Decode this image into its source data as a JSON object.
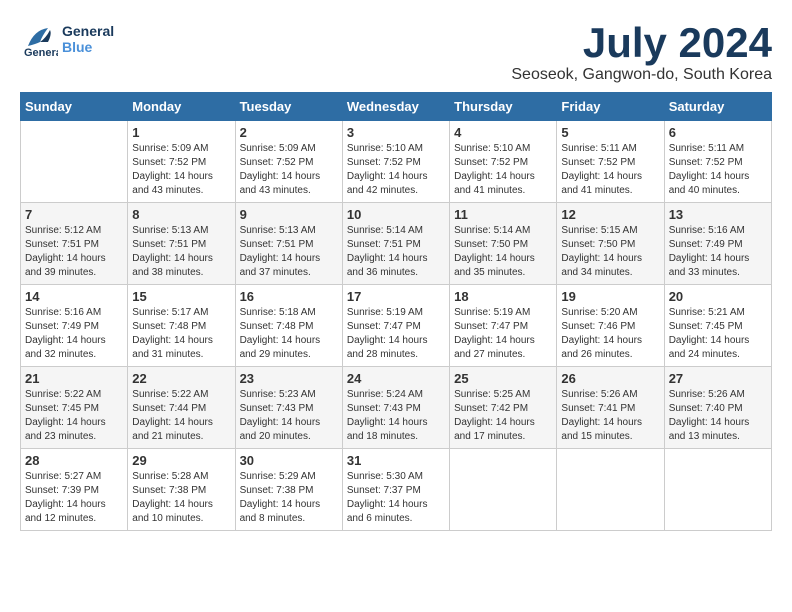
{
  "header": {
    "logo_general": "General",
    "logo_blue": "Blue",
    "month_year": "July 2024",
    "location": "Seoseok, Gangwon-do, South Korea"
  },
  "days_of_week": [
    "Sunday",
    "Monday",
    "Tuesday",
    "Wednesday",
    "Thursday",
    "Friday",
    "Saturday"
  ],
  "weeks": [
    [
      {
        "day": "",
        "info": ""
      },
      {
        "day": "1",
        "info": "Sunrise: 5:09 AM\nSunset: 7:52 PM\nDaylight: 14 hours\nand 43 minutes."
      },
      {
        "day": "2",
        "info": "Sunrise: 5:09 AM\nSunset: 7:52 PM\nDaylight: 14 hours\nand 43 minutes."
      },
      {
        "day": "3",
        "info": "Sunrise: 5:10 AM\nSunset: 7:52 PM\nDaylight: 14 hours\nand 42 minutes."
      },
      {
        "day": "4",
        "info": "Sunrise: 5:10 AM\nSunset: 7:52 PM\nDaylight: 14 hours\nand 41 minutes."
      },
      {
        "day": "5",
        "info": "Sunrise: 5:11 AM\nSunset: 7:52 PM\nDaylight: 14 hours\nand 41 minutes."
      },
      {
        "day": "6",
        "info": "Sunrise: 5:11 AM\nSunset: 7:52 PM\nDaylight: 14 hours\nand 40 minutes."
      }
    ],
    [
      {
        "day": "7",
        "info": "Sunrise: 5:12 AM\nSunset: 7:51 PM\nDaylight: 14 hours\nand 39 minutes."
      },
      {
        "day": "8",
        "info": "Sunrise: 5:13 AM\nSunset: 7:51 PM\nDaylight: 14 hours\nand 38 minutes."
      },
      {
        "day": "9",
        "info": "Sunrise: 5:13 AM\nSunset: 7:51 PM\nDaylight: 14 hours\nand 37 minutes."
      },
      {
        "day": "10",
        "info": "Sunrise: 5:14 AM\nSunset: 7:51 PM\nDaylight: 14 hours\nand 36 minutes."
      },
      {
        "day": "11",
        "info": "Sunrise: 5:14 AM\nSunset: 7:50 PM\nDaylight: 14 hours\nand 35 minutes."
      },
      {
        "day": "12",
        "info": "Sunrise: 5:15 AM\nSunset: 7:50 PM\nDaylight: 14 hours\nand 34 minutes."
      },
      {
        "day": "13",
        "info": "Sunrise: 5:16 AM\nSunset: 7:49 PM\nDaylight: 14 hours\nand 33 minutes."
      }
    ],
    [
      {
        "day": "14",
        "info": "Sunrise: 5:16 AM\nSunset: 7:49 PM\nDaylight: 14 hours\nand 32 minutes."
      },
      {
        "day": "15",
        "info": "Sunrise: 5:17 AM\nSunset: 7:48 PM\nDaylight: 14 hours\nand 31 minutes."
      },
      {
        "day": "16",
        "info": "Sunrise: 5:18 AM\nSunset: 7:48 PM\nDaylight: 14 hours\nand 29 minutes."
      },
      {
        "day": "17",
        "info": "Sunrise: 5:19 AM\nSunset: 7:47 PM\nDaylight: 14 hours\nand 28 minutes."
      },
      {
        "day": "18",
        "info": "Sunrise: 5:19 AM\nSunset: 7:47 PM\nDaylight: 14 hours\nand 27 minutes."
      },
      {
        "day": "19",
        "info": "Sunrise: 5:20 AM\nSunset: 7:46 PM\nDaylight: 14 hours\nand 26 minutes."
      },
      {
        "day": "20",
        "info": "Sunrise: 5:21 AM\nSunset: 7:45 PM\nDaylight: 14 hours\nand 24 minutes."
      }
    ],
    [
      {
        "day": "21",
        "info": "Sunrise: 5:22 AM\nSunset: 7:45 PM\nDaylight: 14 hours\nand 23 minutes."
      },
      {
        "day": "22",
        "info": "Sunrise: 5:22 AM\nSunset: 7:44 PM\nDaylight: 14 hours\nand 21 minutes."
      },
      {
        "day": "23",
        "info": "Sunrise: 5:23 AM\nSunset: 7:43 PM\nDaylight: 14 hours\nand 20 minutes."
      },
      {
        "day": "24",
        "info": "Sunrise: 5:24 AM\nSunset: 7:43 PM\nDaylight: 14 hours\nand 18 minutes."
      },
      {
        "day": "25",
        "info": "Sunrise: 5:25 AM\nSunset: 7:42 PM\nDaylight: 14 hours\nand 17 minutes."
      },
      {
        "day": "26",
        "info": "Sunrise: 5:26 AM\nSunset: 7:41 PM\nDaylight: 14 hours\nand 15 minutes."
      },
      {
        "day": "27",
        "info": "Sunrise: 5:26 AM\nSunset: 7:40 PM\nDaylight: 14 hours\nand 13 minutes."
      }
    ],
    [
      {
        "day": "28",
        "info": "Sunrise: 5:27 AM\nSunset: 7:39 PM\nDaylight: 14 hours\nand 12 minutes."
      },
      {
        "day": "29",
        "info": "Sunrise: 5:28 AM\nSunset: 7:38 PM\nDaylight: 14 hours\nand 10 minutes."
      },
      {
        "day": "30",
        "info": "Sunrise: 5:29 AM\nSunset: 7:38 PM\nDaylight: 14 hours\nand 8 minutes."
      },
      {
        "day": "31",
        "info": "Sunrise: 5:30 AM\nSunset: 7:37 PM\nDaylight: 14 hours\nand 6 minutes."
      },
      {
        "day": "",
        "info": ""
      },
      {
        "day": "",
        "info": ""
      },
      {
        "day": "",
        "info": ""
      }
    ]
  ]
}
